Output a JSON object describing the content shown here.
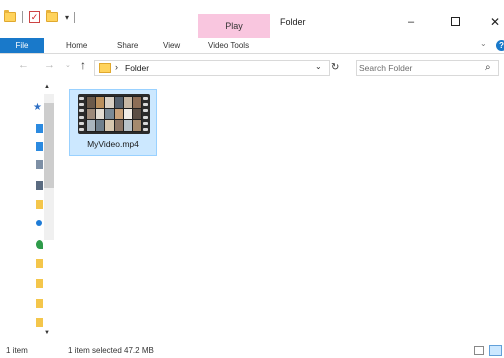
{
  "window": {
    "title": "Folder",
    "context_tab_group": "Play",
    "controls": {
      "minimize": "–",
      "maximize": "",
      "close": "✕"
    }
  },
  "quick_access_toolbar": {
    "customize_glyph": "▾"
  },
  "ribbon": {
    "file_tab": "File",
    "tabs": [
      "Home",
      "Share",
      "View",
      "Video Tools"
    ],
    "collapse_glyph": "⌄",
    "help_glyph": "?"
  },
  "navigation": {
    "back_glyph": "←",
    "forward_glyph": "→",
    "recent_glyph": "⌄",
    "up_glyph": "↑",
    "breadcrumb_separator": "›",
    "breadcrumb": [
      "Folder"
    ],
    "address_dropdown_glyph": "⌄",
    "refresh_glyph": "↻",
    "search": {
      "placeholder": "Search Folder",
      "value": "",
      "icon_glyph": "⌕"
    }
  },
  "nav_pane": {
    "scroll_up_glyph": "▲",
    "scroll_down_glyph": "▼",
    "icons": [
      "quick-access-star-icon",
      "desktop-icon",
      "downloads-icon",
      "documents-icon",
      "pictures-icon",
      "folder-icon",
      "onedrive-icon",
      "music-icon",
      "folder-icon",
      "folder-icon",
      "folder-icon",
      "folder-icon",
      "folder-icon",
      "network-drive-icon"
    ],
    "colors": {
      "star": "#2e6fc4",
      "desktop": "#2b8ae0",
      "downloads": "#2b8ae0",
      "documents": "#7d8fa5",
      "pictures": "#5a6b80",
      "folder": "#f4c64b",
      "onedrive": "#1e7bd6",
      "music": "#2e9b4a",
      "network": "#8bbf3a"
    }
  },
  "files": [
    {
      "name": "MyVideo.mp4",
      "type": "video",
      "selected": true
    }
  ],
  "status_bar": {
    "item_count": "1 item",
    "selection": "1 item selected  47.2 MB"
  },
  "colors": {
    "file_tab": "#1979ca",
    "play_tab": "#f9c6df",
    "selection": "#cce8ff",
    "selection_border": "#99d1ff"
  }
}
